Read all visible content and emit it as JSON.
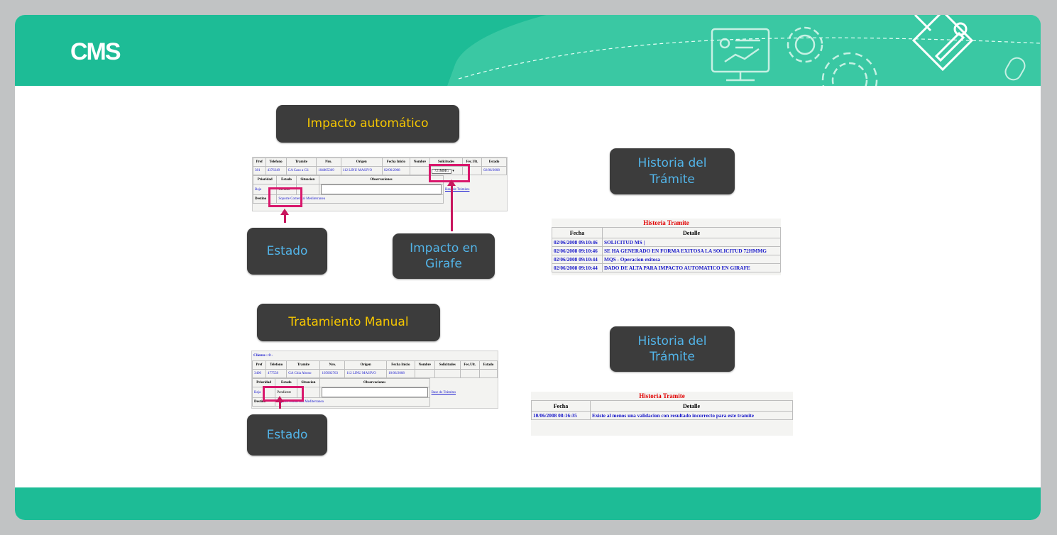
{
  "header": {
    "brand": "CMS"
  },
  "icons": {
    "header_left": "monitor-presentation-icon",
    "header_mid": "gear-icon",
    "header_right": "tools-diamond-icon",
    "header_edge": "mouse-icon"
  },
  "colors": {
    "header": "#1dbc96",
    "pill_bg": "#3c3c3c",
    "yellow_text": "#f6c700",
    "blue_text": "#52b4e8",
    "highlight": "#d9176c"
  },
  "labels": {
    "impacto_automatico": "Impacto automático",
    "estado_1": "Estado",
    "impacto_girafe_1": "Impacto en",
    "impacto_girafe_2": "Girafe",
    "historia_1a": "Historia del",
    "historia_1b": "Trámite",
    "tratamiento_manual": "Tratamiento Manual",
    "historia_2a": "Historia del",
    "historia_2b": "Trámite",
    "estado_2": "Estado"
  },
  "shot1": {
    "headers": [
      "Pref",
      "Telefono",
      "Tramite",
      "Nro.",
      "Origen",
      "Fecha Inicio",
      "Nombre",
      "Solicitudes",
      "Fec.Ult.",
      "Estado"
    ],
    "row": [
      "381",
      "4376349",
      "GA Caso a Cli",
      "104805369",
      "112 LINU MASIVO",
      "02/06/2008",
      "",
      "721MMG",
      "",
      "02/06/2008"
    ],
    "sub_headers": [
      "Prioridad",
      "Estado",
      "Situacion",
      "Observaciones"
    ],
    "prioridad": "Baja",
    "estado": "Cerrado",
    "link": "Base de Trámites",
    "destino_label": "Destino",
    "destino": "Soporte Comercial Mediterranea"
  },
  "shot2": {
    "cliente": "Cliente : 0 -",
    "headers": [
      "Pref",
      "Telefono",
      "Tramite",
      "Nro.",
      "Origen",
      "Fecha Inicio",
      "Nombre",
      "Solicitudes",
      "Fec.Ult.",
      "Estado"
    ],
    "row": [
      "3400",
      "477558",
      "GA Chia Abono",
      "105002763",
      "112 LINU MASIVO",
      "10/06/2008",
      "",
      "",
      "",
      ""
    ],
    "sub_headers": [
      "Prioridad",
      "Estado",
      "Situacion",
      "Observaciones"
    ],
    "prioridad": "Baja",
    "estado": "Pendiente",
    "link": "Base de Trámites",
    "destino_label": "Destino",
    "destino": "Soporte Comercial Mediterranea"
  },
  "historia1": {
    "title": "Historia Tramite",
    "col_fecha": "Fecha",
    "col_detalle": "Detalle",
    "rows": [
      {
        "fecha": "02/06/2008 09:10:46",
        "detalle": "SOLICITUD MS |"
      },
      {
        "fecha": "02/06/2008 09:10:46",
        "detalle": "SE HA GENERADO EN FORMA EXITOSA LA SOLICITUD 72HMMG"
      },
      {
        "fecha": "02/06/2008 09:10:44",
        "detalle": "MQS - Operacion exitosa"
      },
      {
        "fecha": "02/06/2008 09:10:44",
        "detalle": "DADO DE ALTA PARA IMPACTO AUTOMATICO EN GIRAFE"
      }
    ]
  },
  "historia2": {
    "title": "Historia Tramite",
    "col_fecha": "Fecha",
    "col_detalle": "Detalle",
    "rows": [
      {
        "fecha": "10/06/2008 08:16:35",
        "detalle": "Existe al menos una validacion con resultado incorrecto para este tramite"
      }
    ]
  }
}
